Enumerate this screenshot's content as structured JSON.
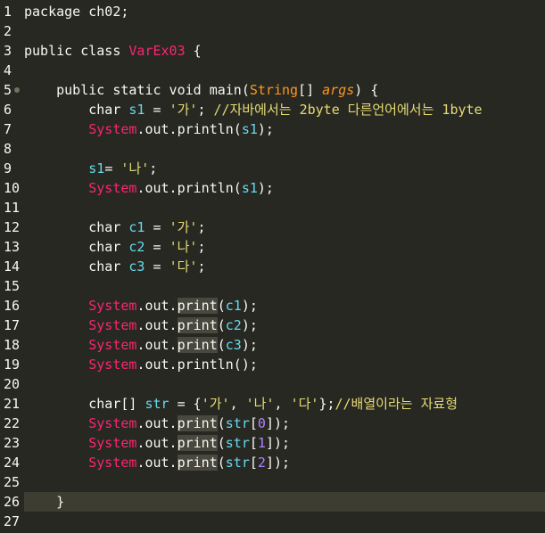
{
  "editor": {
    "lines": [
      {
        "n": "1",
        "text": "package ch02;"
      },
      {
        "n": "2",
        "text": ""
      },
      {
        "n": "3",
        "text": "public class VarEx03 {"
      },
      {
        "n": "4",
        "text": ""
      },
      {
        "n": "5",
        "text": "    public static void main(String[] args) {"
      },
      {
        "n": "6",
        "text": "        char s1 = '가'; //자바에서는 2byte 다른언어에서는 1byte"
      },
      {
        "n": "7",
        "text": "        System.out.println(s1);"
      },
      {
        "n": "8",
        "text": ""
      },
      {
        "n": "9",
        "text": "        s1= '나';"
      },
      {
        "n": "10",
        "text": "        System.out.println(s1);"
      },
      {
        "n": "11",
        "text": ""
      },
      {
        "n": "12",
        "text": "        char c1 = '가';"
      },
      {
        "n": "13",
        "text": "        char c2 = '나';"
      },
      {
        "n": "14",
        "text": "        char c3 = '다';"
      },
      {
        "n": "15",
        "text": ""
      },
      {
        "n": "16",
        "text": "        System.out.print(c1);"
      },
      {
        "n": "17",
        "text": "        System.out.print(c2);"
      },
      {
        "n": "18",
        "text": "        System.out.print(c3);"
      },
      {
        "n": "19",
        "text": "        System.out.println();"
      },
      {
        "n": "20",
        "text": ""
      },
      {
        "n": "21",
        "text": "        char[] str = {'가', '나', '다'};//배열이라는 자료형"
      },
      {
        "n": "22",
        "text": "        System.out.print(str[0]);"
      },
      {
        "n": "23",
        "text": "        System.out.print(str[1]);"
      },
      {
        "n": "24",
        "text": "        System.out.print(str[2]);"
      },
      {
        "n": "25",
        "text": ""
      },
      {
        "n": "26",
        "text": "    }"
      },
      {
        "n": "27",
        "text": ""
      }
    ],
    "current_line": "26",
    "fold_marker_line": "5"
  },
  "colors": {
    "background": "#272822",
    "current_line": "#3e3d32",
    "keyword": "#f8f8f2",
    "class_name": "#f92672",
    "string": "#e6db74",
    "comment": "#e6db74"
  }
}
